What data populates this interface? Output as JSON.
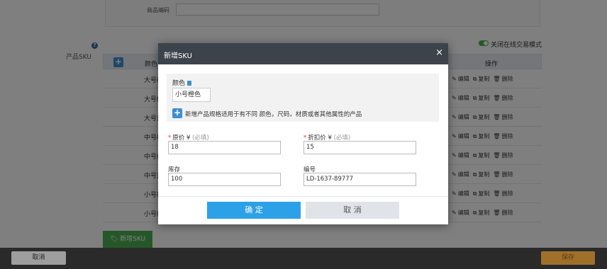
{
  "page": {
    "code_label": "商品编码",
    "sku_label": "产品SKU",
    "help_icon": "?",
    "toggle_label": "关闭在线交易模式",
    "table": {
      "color_header": "颜色",
      "op_header": "操作",
      "rows": [
        {
          "color": "大号橙色"
        },
        {
          "color": "大号红色"
        },
        {
          "color": "大号蓝色"
        },
        {
          "color": "中号橙色"
        },
        {
          "color": "中号红色"
        },
        {
          "color": "中号蓝色"
        },
        {
          "color": "小号橙色"
        },
        {
          "color": "小号红色"
        }
      ],
      "op_edit": "编辑",
      "op_copy": "复制",
      "op_delete": "删除"
    },
    "add_sku_label": "新增SKU",
    "footer": {
      "cancel_label": "取消",
      "save_label": "保存"
    }
  },
  "modal": {
    "title": "新增SKU",
    "close_icon": "×",
    "color_label": "颜色",
    "color_value": "小号橙色",
    "add_attr_desc": "新增产品规格适用于有不同 颜色，尺码，材质或者其他属性的产品",
    "price_label": "原价",
    "price_currency": "¥",
    "price_hint": "(必填)",
    "price_value": "18",
    "discount_label": "折扣价",
    "discount_currency": "¥",
    "discount_hint": "(必填)",
    "discount_value": "15",
    "stock_label": "库存",
    "stock_value": "100",
    "code_label": "编号",
    "code_value": "LD-1637-89777",
    "confirm_label": "确 定",
    "cancel_label": "取 消"
  },
  "colors": {
    "header_bg": "#3c434b",
    "primary": "#2da1e8",
    "green": "#4caf50",
    "required": "#e53935"
  },
  "icons": {
    "edit": "pencil-icon",
    "copy": "copy-icon",
    "delete": "trash-icon",
    "add": "plus-icon",
    "lock": "lock-icon",
    "tag": "tag-icon"
  }
}
